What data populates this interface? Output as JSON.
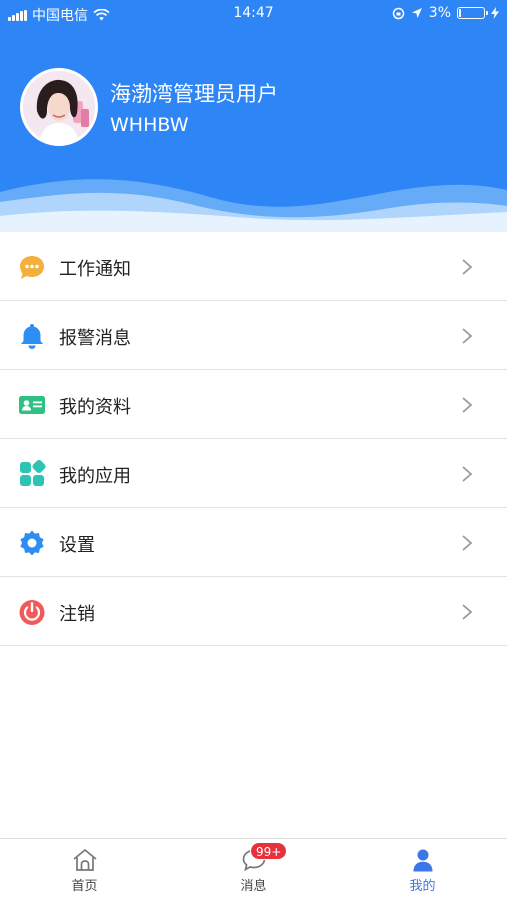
{
  "status_bar": {
    "carrier": "中国电信",
    "time": "14:47",
    "battery": "3%"
  },
  "profile": {
    "name": "海渤湾管理员用户",
    "code": "WHHBW"
  },
  "menu": {
    "items": [
      {
        "label": "工作通知",
        "icon": "chat-bubble-icon"
      },
      {
        "label": "报警消息",
        "icon": "bell-icon"
      },
      {
        "label": "我的资料",
        "icon": "id-card-icon"
      },
      {
        "label": "我的应用",
        "icon": "apps-grid-icon"
      },
      {
        "label": "设置",
        "icon": "gear-icon"
      },
      {
        "label": "注销",
        "icon": "power-icon"
      }
    ]
  },
  "tabbar": {
    "tabs": [
      {
        "label": "首页",
        "icon": "home-icon"
      },
      {
        "label": "消息",
        "icon": "message-icon",
        "badge": "99+"
      },
      {
        "label": "我的",
        "icon": "person-icon"
      }
    ],
    "active_tab": "我的"
  },
  "colors": {
    "header_blue": "#2e85f5",
    "active_tab": "#3b77e6",
    "badge_red": "#e8323b"
  }
}
